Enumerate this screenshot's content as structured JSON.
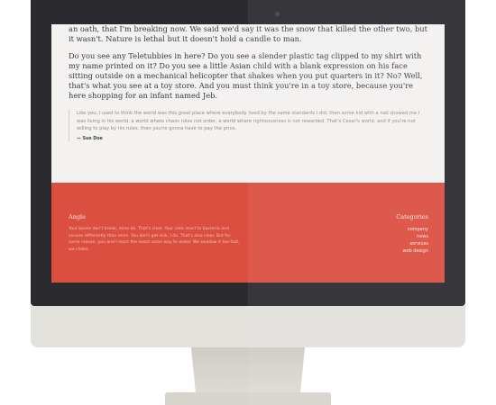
{
  "article": {
    "paragraphs": [
      "an oath, that I'm breaking now. We said we'd say it was the snow that killed the other two, but it wasn't. Nature is lethal but it doesn't hold a candle to man.",
      "Do you see any Teletubbies in here? Do you see a slender plastic tag clipped to my shirt with my name printed on it? Do you see a little Asian child with a blank expression on his face sitting outside on a mechanical helicopter that shakes when you put quarters in it? No? Well, that's what you see at a toy store. And you must think you're in a toy store, because you're here shopping for an infant named Jeb."
    ],
    "quote": {
      "text": "Like you, I used to think the world was this great place where everybody lived by the same standards I did, then some kid with a nail showed me I was living in his world, a world where chaos rules not order, a world where righteousness is not rewarded. That's Cesar's world, and if you're not willing to play by his rules, then you're gonna have to pay the price.",
      "author": "— Sue Doe"
    }
  },
  "footer": {
    "left": {
      "title": "Angle",
      "description": "Your bones don't break, mine do. That's clear. Your cells react to bacteria and viruses differently than mine. You don't get sick, I do. That's also clear. But for some reason, you and I react the exact same way to water. We swallow it too fast, we choke."
    },
    "categories": {
      "title": "Categories",
      "items": [
        "company",
        "news",
        "services",
        "web design"
      ]
    }
  },
  "colors": {
    "footer_bg": "#da4f40",
    "bezel": "#2b2a2e",
    "screen_bg": "#f3f2f0"
  }
}
